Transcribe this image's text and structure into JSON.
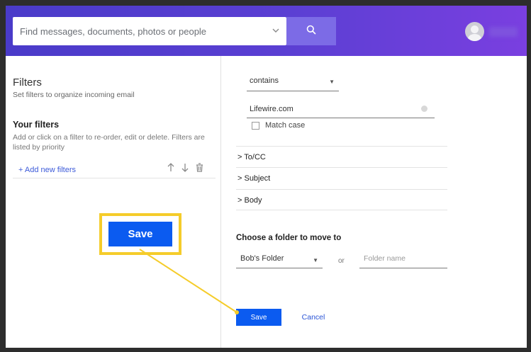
{
  "header": {
    "search_placeholder": "Find messages, documents, photos or people",
    "accent_color": "#5b3fd3"
  },
  "filters": {
    "title": "Filters",
    "subtitle": "Set filters to organize incoming email",
    "your_filters_title": "Your filters",
    "your_filters_desc": "Add or click on a filter to re-order, edit or delete. Filters are listed by priority",
    "add_new_label": "+ Add new filters"
  },
  "callout": {
    "label": "Save",
    "highlight_color": "#f5cc2a"
  },
  "rule": {
    "condition": "contains",
    "value": "Lifewire.com",
    "match_case_label": "Match case",
    "sections": [
      ">  To/CC",
      ">  Subject",
      ">  Body"
    ]
  },
  "folder": {
    "title": "Choose a folder to move to",
    "selected": "Bob's Folder",
    "or_label": "or",
    "name_placeholder": "Folder name"
  },
  "actions": {
    "save_label": "Save",
    "cancel_label": "Cancel",
    "primary_color": "#0b5bf0"
  }
}
